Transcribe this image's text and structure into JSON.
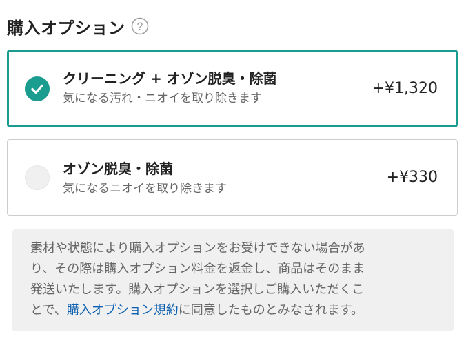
{
  "header": {
    "title": "購入オプション",
    "help_icon": "question-circle-icon"
  },
  "options": [
    {
      "name": "クリーニング + オゾン脱臭・除菌",
      "description": "気になる汚れ・ニオイを取り除きます",
      "price": "+¥1,320",
      "selected": true
    },
    {
      "name": "オゾン脱臭・除菌",
      "description": "気になるニオイを取り除きます",
      "price": "+¥330",
      "selected": false
    }
  ],
  "notice": {
    "line1": "素材や状態により購入オプションをお受けできない場合があ",
    "line2": "り、その際は購入オプション料金を返金し、商品はそのまま",
    "line3": "発送いたします。購入オプションを選択しご購入いただくこ",
    "line4_prefix": "とで、",
    "link_text": "購入オプション規約",
    "line4_suffix": "に同意したものとみなされます。"
  },
  "colors": {
    "accent": "#1a9c8e",
    "link": "#0b5fb0",
    "notice_bg": "#f0f0f0"
  }
}
